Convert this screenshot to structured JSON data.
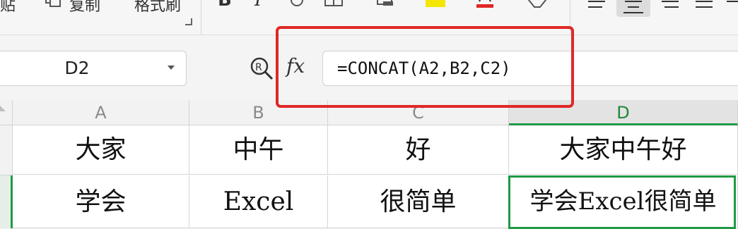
{
  "ribbon": {
    "left_label_partial": "贴",
    "copy_label": "复制",
    "format_painter_label": "格式刷",
    "icons": [
      "copy-icon",
      "bold-icon",
      "italic-icon",
      "underline-icon",
      "border-icon",
      "fill-color-icon",
      "highlight-icon",
      "font-color-icon",
      "clear-format-icon",
      "align-left-icon",
      "align-center-icon",
      "align-right-icon",
      "justify-icon"
    ],
    "highlight_color": "#f5e600",
    "font_color_accent": "#e02727"
  },
  "name_box": {
    "value": "D2"
  },
  "formula_bar": {
    "fx_label": "fx",
    "formula": "=CONCAT(A2,B2,C2)"
  },
  "columns": [
    "A",
    "B",
    "C",
    "D"
  ],
  "rows": [
    [
      "大家",
      "中午",
      "好",
      "大家中午好"
    ],
    [
      "学会",
      "Excel",
      "很简单",
      "学会Excel很简单"
    ]
  ],
  "colors": {
    "annotation_red": "#e02727",
    "active_green": "#1f9a46"
  }
}
